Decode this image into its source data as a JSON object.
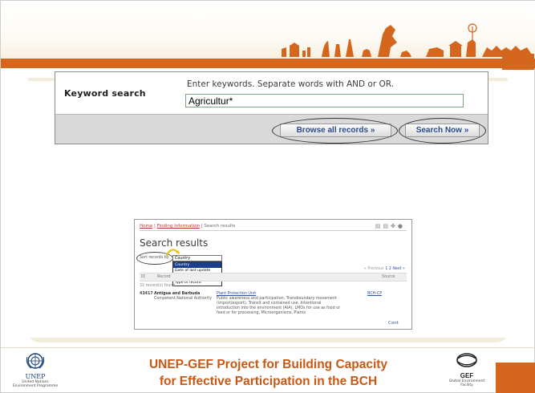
{
  "search_form": {
    "label": "Keyword search",
    "hint": "Enter keywords. Separate words with AND or OR.",
    "keyword_value": "Agricultur*",
    "browse_button": "Browse all records »",
    "search_button": "Search Now »"
  },
  "screenshot": {
    "breadcrumb": {
      "home": "Home",
      "sep1": " | ",
      "finding": "Finding Information",
      "sep2": " | ",
      "current": "Search results"
    },
    "title": "Search results",
    "sort_label": "Sort records by",
    "sort_selected": "Country",
    "sort_options": [
      "Country",
      "Date of last update",
      "Subject Area",
      "Type of record"
    ],
    "pager": {
      "previous": "« Previous",
      "pages": "1 2",
      "next": "Next »"
    },
    "columns": {
      "id": "ID",
      "record": "Record",
      "source": "Source"
    },
    "record_count": "31 record(s) found",
    "row": {
      "id": "43417",
      "country": "Antigua and Barbuda",
      "agency": "Competent National Authority",
      "record_name": "Plant Protection Unit",
      "record_desc": "Public awareness and participation, Transboundary movement (import/export), Transit and contained use, Intentional introduction into the environment (AIA), LMOs for use as food or feed or for processing, Microorganisms, Plants",
      "source": "BCH-CP"
    },
    "continue": "Cont"
  },
  "footer": {
    "line1": "UNEP-GEF Project for Building Capacity",
    "line2": "for Effective Participation in the BCH",
    "unep_name": "UNEP",
    "unep_sub1": "United Nations",
    "unep_sub2": "Environment Programme",
    "gef_name": "GEF",
    "gef_sub1": "Global Environment",
    "gef_sub2": "Facility"
  },
  "colors": {
    "accent_orange": "#d5661d",
    "footer_text": "#c85814",
    "panel_beige": "#f3ecd9",
    "button_text": "#2b4c8c"
  }
}
